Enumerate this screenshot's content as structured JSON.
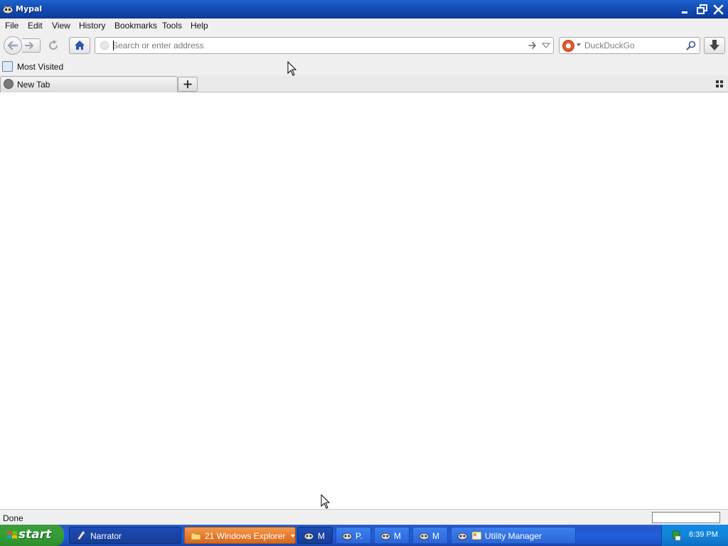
{
  "window": {
    "title": "Mypal",
    "controls": [
      "minimize",
      "maximize",
      "close"
    ]
  },
  "menu": {
    "items": [
      "File",
      "Edit",
      "View",
      "History",
      "Bookmarks",
      "Tools",
      "Help"
    ]
  },
  "navbar": {
    "url_placeholder": "Search or enter address",
    "url_value": "",
    "search_engine": "DuckDuckGo",
    "search_placeholder": "DuckDuckGo"
  },
  "bookmarks": {
    "items": [
      {
        "label": "Most Visited",
        "icon": "most-visited-icon"
      }
    ]
  },
  "tabs": {
    "items": [
      {
        "label": "New Tab",
        "active": true
      }
    ]
  },
  "status": {
    "text": "Done"
  },
  "taskbar": {
    "start_label": "start",
    "tasks": [
      {
        "label": "Narrator",
        "icon": "narrator-icon"
      },
      {
        "label": "21 Windows Explorer",
        "icon": "folder-icon",
        "active": true
      },
      {
        "label": "M",
        "icon": "mypal-icon"
      },
      {
        "label": "P.",
        "icon": "mypal-icon"
      },
      {
        "label": "M",
        "icon": "mypal-icon"
      },
      {
        "label": "M",
        "icon": "mypal-icon"
      },
      {
        "label": "Utility Manager",
        "icon": "utility-manager-icon"
      }
    ],
    "clock": "6:39 PM"
  },
  "colors": {
    "titlebar": "#1450b8",
    "taskbar": "#245edb",
    "start": "#35a135",
    "active_task": "#e5772a",
    "chrome": "#f0f0f0"
  }
}
